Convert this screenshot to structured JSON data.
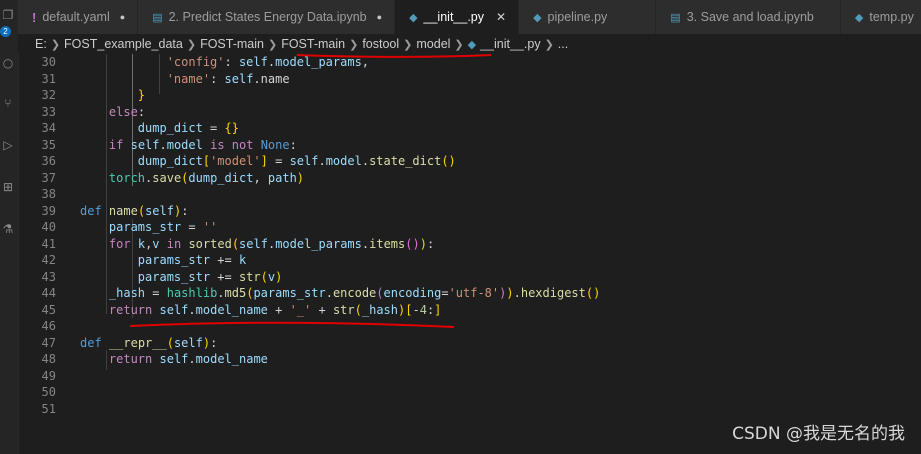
{
  "tabs": [
    {
      "label": "default.yaml",
      "icon": "yaml-exclamation-icon",
      "modified": true
    },
    {
      "label": "2. Predict States Energy Data.ipynb",
      "icon": "notebook-icon"
    },
    {
      "label": "__init__.py",
      "icon": "python-icon",
      "active": true
    },
    {
      "label": "pipeline.py",
      "icon": "python-icon"
    },
    {
      "label": "3. Save and load.ipynb",
      "icon": "notebook-icon"
    },
    {
      "label": "temp.py",
      "icon": "python-icon"
    }
  ],
  "activity_bar": {
    "badge": "2"
  },
  "breadcrumb": [
    "E:",
    "FOST_example_data",
    "FOST-main",
    "FOST-main",
    "fostool",
    "model",
    "__init__.py",
    "..."
  ],
  "code_lines": [
    {
      "n": "30",
      "text": "            'config': self.model_params,"
    },
    {
      "n": "31",
      "text": "            'name': self.name"
    },
    {
      "n": "32",
      "text": "        }"
    },
    {
      "n": "33",
      "text": "    else:"
    },
    {
      "n": "34",
      "text": "        dump_dict = {}"
    },
    {
      "n": "35",
      "text": "    if self.model is not None:"
    },
    {
      "n": "36",
      "text": "        dump_dict['model'] = self.model.state_dict()"
    },
    {
      "n": "37",
      "text": "    torch.save(dump_dict, path)"
    },
    {
      "n": "38",
      "text": ""
    },
    {
      "n": "39",
      "text": "def name(self):"
    },
    {
      "n": "40",
      "text": "    params_str = ''"
    },
    {
      "n": "41",
      "text": "    for k,v in sorted(self.model_params.items()):"
    },
    {
      "n": "42",
      "text": "        params_str += k"
    },
    {
      "n": "43",
      "text": "        params_str += str(v)"
    },
    {
      "n": "44",
      "text": "    _hash = hashlib.md5(params_str.encode(encoding='utf-8')).hexdigest()"
    },
    {
      "n": "45",
      "text": "    return self.model_name + '_' + str(_hash)[-4:]"
    },
    {
      "n": "46",
      "text": ""
    },
    {
      "n": "47",
      "text": "def __repr__(self):"
    },
    {
      "n": "48",
      "text": "    return self.model_name"
    },
    {
      "n": "49",
      "text": ""
    },
    {
      "n": "50",
      "text": ""
    },
    {
      "n": "51",
      "text": ""
    }
  ],
  "watermark": "CSDN @我是无名的我",
  "colors": {
    "keyword": "#c586c0",
    "storage": "#569cd6",
    "string": "#ce9178",
    "variable": "#9cdcfe",
    "function": "#dcdcaa",
    "annotation": "#e00000"
  }
}
